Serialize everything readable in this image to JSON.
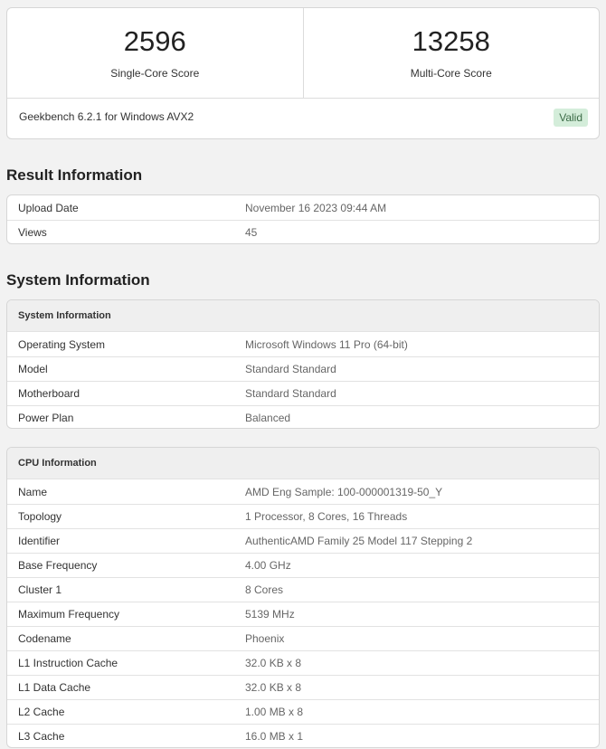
{
  "scores": {
    "single": {
      "value": "2596",
      "label": "Single-Core Score"
    },
    "multi": {
      "value": "13258",
      "label": "Multi-Core Score"
    },
    "version": "Geekbench 6.2.1 for Windows AVX2",
    "badge": "Valid"
  },
  "result_info": {
    "title": "Result Information",
    "rows": [
      {
        "key": "Upload Date",
        "value": "November 16 2023 09:44 AM"
      },
      {
        "key": "Views",
        "value": "45"
      }
    ]
  },
  "system_section": {
    "title": "System Information"
  },
  "system_info": {
    "header": "System Information",
    "rows": [
      {
        "key": "Operating System",
        "value": "Microsoft Windows 11 Pro (64-bit)"
      },
      {
        "key": "Model",
        "value": "Standard Standard"
      },
      {
        "key": "Motherboard",
        "value": "Standard Standard"
      },
      {
        "key": "Power Plan",
        "value": "Balanced"
      }
    ]
  },
  "cpu_info": {
    "header": "CPU Information",
    "rows": [
      {
        "key": "Name",
        "value": "AMD Eng Sample: 100-000001319-50_Y"
      },
      {
        "key": "Topology",
        "value": "1 Processor, 8 Cores, 16 Threads"
      },
      {
        "key": "Identifier",
        "value": "AuthenticAMD Family 25 Model 117 Stepping 2"
      },
      {
        "key": "Base Frequency",
        "value": "4.00 GHz"
      },
      {
        "key": "Cluster 1",
        "value": "8 Cores"
      },
      {
        "key": "Maximum Frequency",
        "value": "5139 MHz"
      },
      {
        "key": "Codename",
        "value": "Phoenix"
      },
      {
        "key": "L1 Instruction Cache",
        "value": "32.0 KB x 8"
      },
      {
        "key": "L1 Data Cache",
        "value": "32.0 KB x 8"
      },
      {
        "key": "L2 Cache",
        "value": "1.00 MB x 8"
      },
      {
        "key": "L3 Cache",
        "value": "16.0 MB x 1"
      }
    ]
  }
}
